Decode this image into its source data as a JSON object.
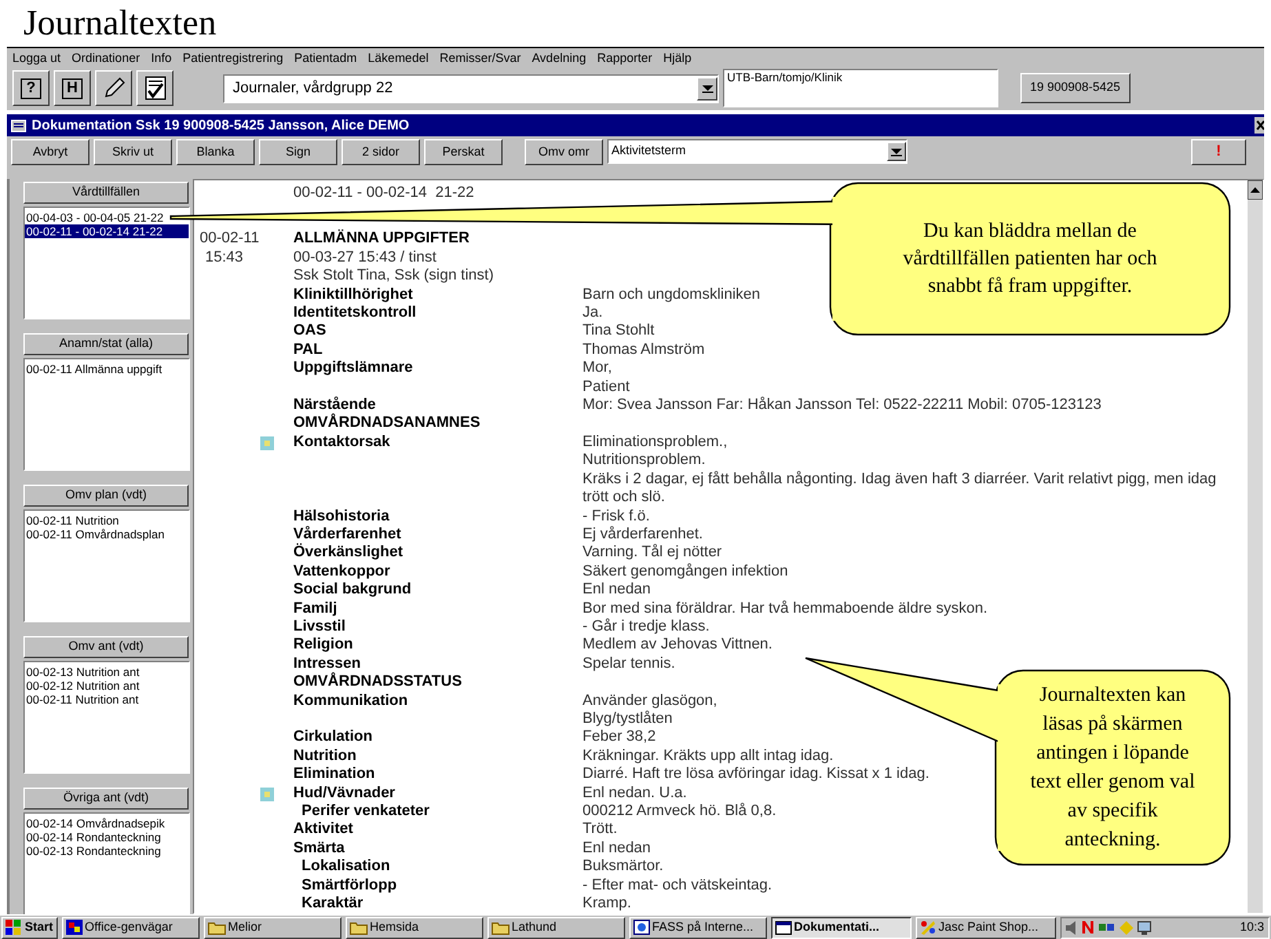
{
  "heading": "Journaltexten",
  "menu": [
    "Logga ut",
    "Ordinationer",
    "Info",
    "Patientregistrering",
    "Patientadm",
    "Läkemedel",
    "Remisser/Svar",
    "Avdelning",
    "Rapporter",
    "Hjälp"
  ],
  "toolbar": {
    "tools": [
      {
        "kind": "help",
        "label": "?"
      },
      {
        "kind": "letter",
        "label": "H"
      },
      {
        "kind": "pencil"
      },
      {
        "kind": "checklist"
      }
    ],
    "journal_select": {
      "value": "Journaler, vårdgrupp 22"
    },
    "unit": "UTB-Barn/tomjo/Klinik",
    "patient_button": "19 900908-5425"
  },
  "document": {
    "title": "Dokumentation Ssk 19 900908-5425 Jansson, Alice DEMO",
    "buttons": [
      "Avbryt",
      "Skriv ut",
      "Blanka",
      "Sign",
      "2 sidor",
      "Perskat"
    ],
    "area_button": "Omv omr",
    "term_select": {
      "value": "Aktivitetsterm"
    },
    "alert_button": "!"
  },
  "sidebar": {
    "groups": [
      {
        "button": "Vårdtillfällen",
        "items": [
          {
            "text": "00-04-03 - 00-04-05 21-22",
            "selected": false
          },
          {
            "text": "00-02-11 - 00-02-14 21-22",
            "selected": true
          }
        ]
      },
      {
        "button": "Anamn/stat (alla)",
        "items": [
          {
            "text": "00-02-11  Allmänna uppgift",
            "selected": false
          }
        ]
      },
      {
        "button": "Omv plan (vdt)",
        "items": [
          {
            "text": "00-02-11  Nutrition",
            "selected": false
          },
          {
            "text": "00-02-11  Omvårdnadsplan",
            "selected": false
          }
        ]
      },
      {
        "button": "Omv ant (vdt)",
        "items": [
          {
            "text": "00-02-13  Nutrition ant",
            "selected": false
          },
          {
            "text": "00-02-12  Nutrition ant",
            "selected": false
          },
          {
            "text": "00-02-11  Nutrition ant",
            "selected": false
          }
        ]
      },
      {
        "button": "Övriga ant (vdt)",
        "items": [
          {
            "text": "00-02-14  Omvårdnadsepik",
            "selected": false
          },
          {
            "text": "00-02-14  Rondanteckning",
            "selected": false
          },
          {
            "text": "00-02-13  Rondanteckning",
            "selected": false
          }
        ]
      }
    ]
  },
  "journal": {
    "period": "00-02-11 - 00-02-14  21-22",
    "note": {
      "date": "00-02-11",
      "time": "15:43",
      "title": "ALLMÄNNA UPPGIFTER",
      "meta": [
        "00-03-27 15:43 / tinst",
        "Ssk Stolt Tina, Ssk (sign tinst)"
      ],
      "rows": [
        {
          "kind": "field",
          "label": "Kliniktillhörighet",
          "values": [
            "Barn och ungdomskliniken"
          ],
          "indent": false,
          "marked": false
        },
        {
          "kind": "field",
          "label": "Identitetskontroll",
          "values": [
            "Ja."
          ],
          "indent": false,
          "marked": false
        },
        {
          "kind": "field",
          "label": "OAS",
          "values": [
            "Tina Stohlt"
          ],
          "indent": false,
          "marked": false
        },
        {
          "kind": "field",
          "label": "PAL",
          "values": [
            "Thomas Almström"
          ],
          "indent": false,
          "marked": false
        },
        {
          "kind": "field",
          "label": "Uppgiftslämnare",
          "values": [
            "Mor,",
            "Patient"
          ],
          "indent": false,
          "marked": false
        },
        {
          "kind": "field",
          "label": "Närstående",
          "values": [
            "Mor: Svea Jansson Far: Håkan Jansson Tel: 0522-22211 Mobil: 0705-123123"
          ],
          "indent": false,
          "marked": false
        },
        {
          "kind": "section",
          "label": "OMVÅRDNADSANAMNES",
          "indent": false,
          "marked": false
        },
        {
          "kind": "field",
          "label": "Kontaktorsak",
          "values": [
            "Eliminationsproblem.,",
            "Nutritionsproblem.",
            "Kräks i 2 dagar, ej fått behålla någonting. Idag även haft 3 diarréer. Varit relativt pigg, men idag trött och slö."
          ],
          "indent": false,
          "marked": true
        },
        {
          "kind": "field",
          "label": "Hälsohistoria",
          "values": [
            "- Frisk f.ö."
          ],
          "indent": false,
          "marked": false
        },
        {
          "kind": "field",
          "label": "Vårderfarenhet",
          "values": [
            "Ej vårderfarenhet."
          ],
          "indent": false,
          "marked": false
        },
        {
          "kind": "field",
          "label": "Överkänslighet",
          "values": [
            "Varning. Tål ej nötter"
          ],
          "indent": false,
          "marked": false
        },
        {
          "kind": "field",
          "label": "Vattenkoppor",
          "values": [
            "Säkert genomgången infektion"
          ],
          "indent": false,
          "marked": false
        },
        {
          "kind": "field",
          "label": "Social bakgrund",
          "values": [
            "Enl nedan"
          ],
          "indent": false,
          "marked": false
        },
        {
          "kind": "field",
          "label": "Familj",
          "values": [
            "Bor med sina föräldrar. Har två hemmaboende äldre syskon."
          ],
          "indent": false,
          "marked": false
        },
        {
          "kind": "field",
          "label": "Livsstil",
          "values": [
            "- Går i tredje klass."
          ],
          "indent": false,
          "marked": false
        },
        {
          "kind": "field",
          "label": "Religion",
          "values": [
            "Medlem av Jehovas Vittnen."
          ],
          "indent": false,
          "marked": false
        },
        {
          "kind": "field",
          "label": "Intressen",
          "values": [
            "Spelar tennis."
          ],
          "indent": false,
          "marked": false
        },
        {
          "kind": "section",
          "label": "OMVÅRDNADSSTATUS",
          "indent": false,
          "marked": false
        },
        {
          "kind": "field",
          "label": "Kommunikation",
          "values": [
            "Använder glasögon,",
            "Blyg/tystlåten"
          ],
          "indent": false,
          "marked": false
        },
        {
          "kind": "field",
          "label": "Cirkulation",
          "values": [
            "Feber 38,2"
          ],
          "indent": false,
          "marked": false
        },
        {
          "kind": "field",
          "label": "Nutrition",
          "values": [
            "Kräkningar. Kräkts upp allt intag idag."
          ],
          "indent": false,
          "marked": false
        },
        {
          "kind": "field",
          "label": "Elimination",
          "values": [
            "Diarré. Haft tre lösa avföringar idag. Kissat x 1 idag."
          ],
          "indent": false,
          "marked": false
        },
        {
          "kind": "field",
          "label": "Hud/Vävnader",
          "values": [
            "Enl nedan. U.a."
          ],
          "indent": false,
          "marked": true
        },
        {
          "kind": "field",
          "label": "Perifer venkateter",
          "values": [
            "000212 Armveck hö. Blå 0,8."
          ],
          "indent": true,
          "marked": false
        },
        {
          "kind": "field",
          "label": "Aktivitet",
          "values": [
            "Trött."
          ],
          "indent": false,
          "marked": false
        },
        {
          "kind": "field",
          "label": "Smärta",
          "values": [
            "Enl nedan"
          ],
          "indent": false,
          "marked": false
        },
        {
          "kind": "field",
          "label": "Lokalisation",
          "values": [
            "Buksmärtor."
          ],
          "indent": true,
          "marked": false
        },
        {
          "kind": "field",
          "label": "Smärtförlopp",
          "values": [
            "- Efter mat- och vätskeintag."
          ],
          "indent": true,
          "marked": false
        },
        {
          "kind": "field",
          "label": "Karaktär",
          "values": [
            "Kramp."
          ],
          "indent": true,
          "marked": false
        }
      ]
    }
  },
  "callouts": [
    {
      "text": "Du kan  bläddra mellan de vårdtillfällen patienten har och snabbt få fram uppgifter."
    },
    {
      "text": "Journaltexten kan läsas på skärmen antingen i löpande text  eller genom val av specifik anteckning."
    }
  ],
  "taskbar": {
    "start": "Start",
    "tasks": [
      {
        "kind": "office",
        "label": "Office-genvägar",
        "selected": false
      },
      {
        "kind": "folder",
        "label": "Melior",
        "selected": false
      },
      {
        "kind": "folder",
        "label": "Hemsida",
        "selected": false
      },
      {
        "kind": "folder",
        "label": "Lathund",
        "selected": false
      },
      {
        "kind": "browser",
        "label": "FASS på Interne...",
        "selected": false
      },
      {
        "kind": "window",
        "label": "Dokumentati...",
        "selected": true
      },
      {
        "kind": "paint",
        "label": "Jasc Paint Shop...",
        "selected": false
      }
    ],
    "clock": "10:3"
  }
}
